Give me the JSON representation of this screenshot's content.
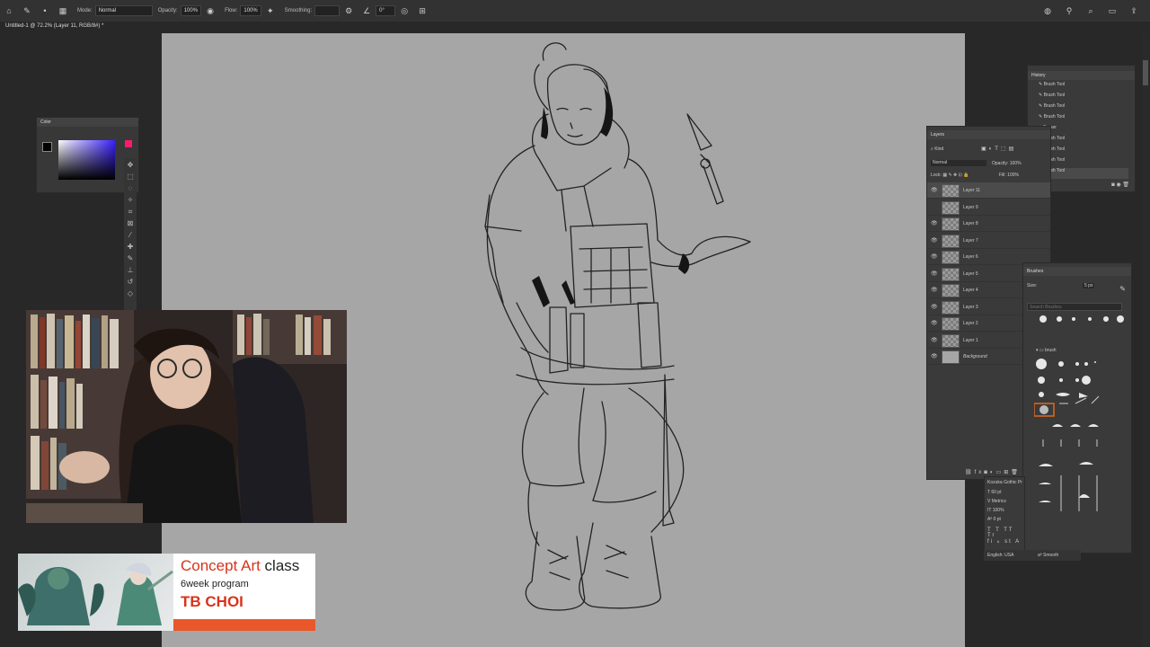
{
  "options_bar": {
    "mode_label": "Mode:",
    "mode_value": "Normal",
    "opacity_label": "Opacity:",
    "opacity_value": "100%",
    "flow_label": "Flow:",
    "flow_value": "100%",
    "smoothing_label": "Smoothing:",
    "smoothing_value": "",
    "angle_value": "0°"
  },
  "document_tab": {
    "title": "Untitled-1 @ 72.2% (Layer 11, RGB/8#) *"
  },
  "color_panel": {
    "title": "Color",
    "foreground": "#000000",
    "background": "#ffffff",
    "accent": "#ff1a6e"
  },
  "layers_panel": {
    "title": "Layers",
    "kind_label": "Kind",
    "blend_mode": "Normal",
    "opacity_label": "Opacity:",
    "opacity_value": "100%",
    "lock_label": "Lock:",
    "fill_label": "Fill:",
    "fill_value": "100%",
    "layers": [
      {
        "name": "Layer 11",
        "visible": true,
        "selected": true
      },
      {
        "name": "Layer 9",
        "visible": false,
        "selected": false
      },
      {
        "name": "Layer 8",
        "visible": true,
        "selected": false
      },
      {
        "name": "Layer 7",
        "visible": true,
        "selected": false
      },
      {
        "name": "Layer 6",
        "visible": true,
        "selected": false
      },
      {
        "name": "Layer 5",
        "visible": true,
        "selected": false
      },
      {
        "name": "Layer 4",
        "visible": true,
        "selected": false
      },
      {
        "name": "Layer 3",
        "visible": true,
        "selected": false
      },
      {
        "name": "Layer 2",
        "visible": true,
        "selected": false
      },
      {
        "name": "Layer 1",
        "visible": true,
        "selected": false
      },
      {
        "name": "Background",
        "visible": true,
        "selected": false
      }
    ]
  },
  "history_panel": {
    "title": "History",
    "items": [
      "Brush Tool",
      "Brush Tool",
      "Brush Tool",
      "Brush Tool",
      "Eraser",
      "Brush Tool",
      "Brush Tool",
      "Brush Tool",
      "Brush Tool"
    ]
  },
  "brushes_panel": {
    "title": "Brushes",
    "size_label": "Size:",
    "size_value": "5 px",
    "search_placeholder": "Search Brushes",
    "group_name": "brush"
  },
  "character_panel": {
    "font": "Kozuka Gothic Pr",
    "size": "60 pt",
    "kerning": "Metrics",
    "scale": "100%",
    "baseline": "0 pt"
  },
  "status_bar": {
    "language": "English: USA",
    "antialias": "Smooth"
  },
  "banner": {
    "title_a": "Concept Art",
    "title_b": " class",
    "subtitle": "6week program",
    "name": "TB CHOI",
    "accent": "#d9331a"
  }
}
